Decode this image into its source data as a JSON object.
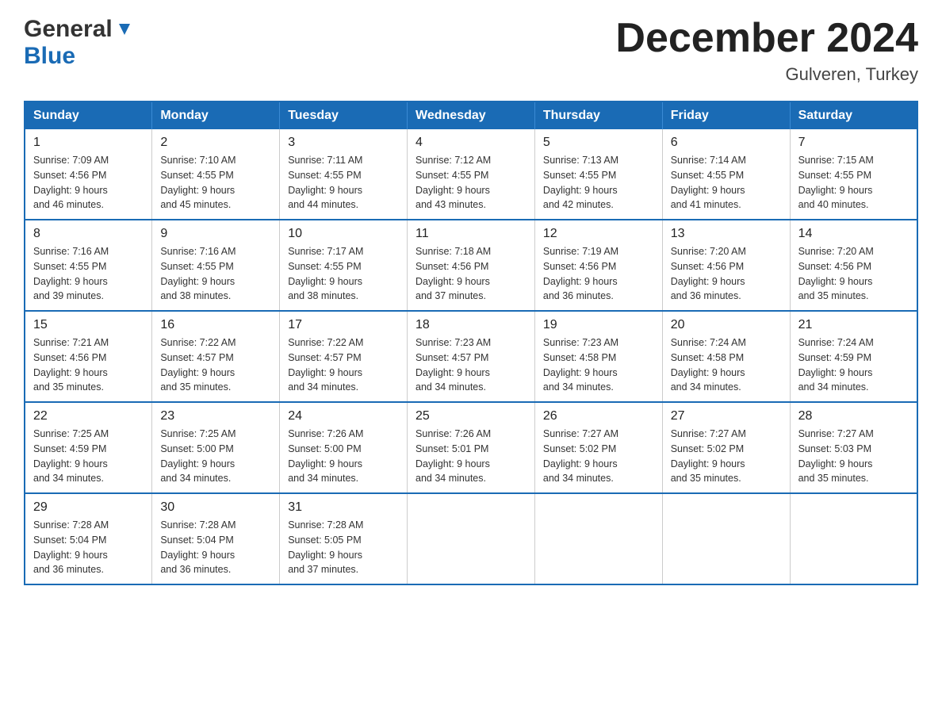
{
  "header": {
    "logo_general": "General",
    "logo_blue": "Blue",
    "month_title": "December 2024",
    "location": "Gulveren, Turkey"
  },
  "days_of_week": [
    "Sunday",
    "Monday",
    "Tuesday",
    "Wednesday",
    "Thursday",
    "Friday",
    "Saturday"
  ],
  "weeks": [
    [
      {
        "day": "1",
        "sunrise": "7:09 AM",
        "sunset": "4:56 PM",
        "daylight": "9 hours and 46 minutes."
      },
      {
        "day": "2",
        "sunrise": "7:10 AM",
        "sunset": "4:55 PM",
        "daylight": "9 hours and 45 minutes."
      },
      {
        "day": "3",
        "sunrise": "7:11 AM",
        "sunset": "4:55 PM",
        "daylight": "9 hours and 44 minutes."
      },
      {
        "day": "4",
        "sunrise": "7:12 AM",
        "sunset": "4:55 PM",
        "daylight": "9 hours and 43 minutes."
      },
      {
        "day": "5",
        "sunrise": "7:13 AM",
        "sunset": "4:55 PM",
        "daylight": "9 hours and 42 minutes."
      },
      {
        "day": "6",
        "sunrise": "7:14 AM",
        "sunset": "4:55 PM",
        "daylight": "9 hours and 41 minutes."
      },
      {
        "day": "7",
        "sunrise": "7:15 AM",
        "sunset": "4:55 PM",
        "daylight": "9 hours and 40 minutes."
      }
    ],
    [
      {
        "day": "8",
        "sunrise": "7:16 AM",
        "sunset": "4:55 PM",
        "daylight": "9 hours and 39 minutes."
      },
      {
        "day": "9",
        "sunrise": "7:16 AM",
        "sunset": "4:55 PM",
        "daylight": "9 hours and 38 minutes."
      },
      {
        "day": "10",
        "sunrise": "7:17 AM",
        "sunset": "4:55 PM",
        "daylight": "9 hours and 38 minutes."
      },
      {
        "day": "11",
        "sunrise": "7:18 AM",
        "sunset": "4:56 PM",
        "daylight": "9 hours and 37 minutes."
      },
      {
        "day": "12",
        "sunrise": "7:19 AM",
        "sunset": "4:56 PM",
        "daylight": "9 hours and 36 minutes."
      },
      {
        "day": "13",
        "sunrise": "7:20 AM",
        "sunset": "4:56 PM",
        "daylight": "9 hours and 36 minutes."
      },
      {
        "day": "14",
        "sunrise": "7:20 AM",
        "sunset": "4:56 PM",
        "daylight": "9 hours and 35 minutes."
      }
    ],
    [
      {
        "day": "15",
        "sunrise": "7:21 AM",
        "sunset": "4:56 PM",
        "daylight": "9 hours and 35 minutes."
      },
      {
        "day": "16",
        "sunrise": "7:22 AM",
        "sunset": "4:57 PM",
        "daylight": "9 hours and 35 minutes."
      },
      {
        "day": "17",
        "sunrise": "7:22 AM",
        "sunset": "4:57 PM",
        "daylight": "9 hours and 34 minutes."
      },
      {
        "day": "18",
        "sunrise": "7:23 AM",
        "sunset": "4:57 PM",
        "daylight": "9 hours and 34 minutes."
      },
      {
        "day": "19",
        "sunrise": "7:23 AM",
        "sunset": "4:58 PM",
        "daylight": "9 hours and 34 minutes."
      },
      {
        "day": "20",
        "sunrise": "7:24 AM",
        "sunset": "4:58 PM",
        "daylight": "9 hours and 34 minutes."
      },
      {
        "day": "21",
        "sunrise": "7:24 AM",
        "sunset": "4:59 PM",
        "daylight": "9 hours and 34 minutes."
      }
    ],
    [
      {
        "day": "22",
        "sunrise": "7:25 AM",
        "sunset": "4:59 PM",
        "daylight": "9 hours and 34 minutes."
      },
      {
        "day": "23",
        "sunrise": "7:25 AM",
        "sunset": "5:00 PM",
        "daylight": "9 hours and 34 minutes."
      },
      {
        "day": "24",
        "sunrise": "7:26 AM",
        "sunset": "5:00 PM",
        "daylight": "9 hours and 34 minutes."
      },
      {
        "day": "25",
        "sunrise": "7:26 AM",
        "sunset": "5:01 PM",
        "daylight": "9 hours and 34 minutes."
      },
      {
        "day": "26",
        "sunrise": "7:27 AM",
        "sunset": "5:02 PM",
        "daylight": "9 hours and 34 minutes."
      },
      {
        "day": "27",
        "sunrise": "7:27 AM",
        "sunset": "5:02 PM",
        "daylight": "9 hours and 35 minutes."
      },
      {
        "day": "28",
        "sunrise": "7:27 AM",
        "sunset": "5:03 PM",
        "daylight": "9 hours and 35 minutes."
      }
    ],
    [
      {
        "day": "29",
        "sunrise": "7:28 AM",
        "sunset": "5:04 PM",
        "daylight": "9 hours and 36 minutes."
      },
      {
        "day": "30",
        "sunrise": "7:28 AM",
        "sunset": "5:04 PM",
        "daylight": "9 hours and 36 minutes."
      },
      {
        "day": "31",
        "sunrise": "7:28 AM",
        "sunset": "5:05 PM",
        "daylight": "9 hours and 37 minutes."
      },
      null,
      null,
      null,
      null
    ]
  ],
  "labels": {
    "sunrise": "Sunrise:",
    "sunset": "Sunset:",
    "daylight": "Daylight:"
  }
}
